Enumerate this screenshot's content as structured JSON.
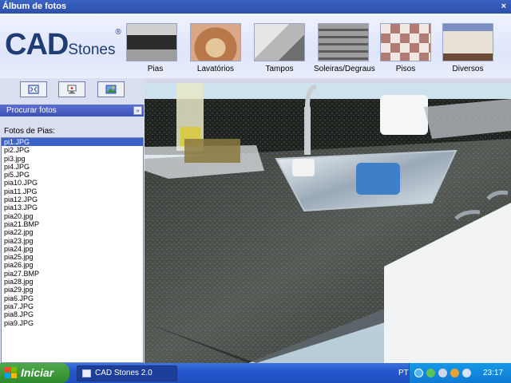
{
  "window": {
    "title": "Álbum de fotos",
    "close_glyph": "×"
  },
  "logo": {
    "main": "CAD",
    "sub": "Stones",
    "reg": "®"
  },
  "categories": [
    {
      "label": "Pias",
      "icon": "sink-thumbnail"
    },
    {
      "label": "Lavatórios",
      "icon": "washbasin-thumbnail"
    },
    {
      "label": "Tampos",
      "icon": "countertop-thumbnail"
    },
    {
      "label": "Soleiras/Degraus",
      "icon": "stairs-thumbnail"
    },
    {
      "label": "Pisos",
      "icon": "floor-thumbnail"
    },
    {
      "label": "Diversos",
      "icon": "misc-thumbnail"
    }
  ],
  "toolbar": [
    {
      "icon": "fit-image-icon"
    },
    {
      "icon": "monitor-icon"
    },
    {
      "icon": "save-image-icon"
    }
  ],
  "search": {
    "label": "Procurar fotos",
    "chevron": "»"
  },
  "files": {
    "title": "Fotos de Pias:",
    "selected": "pi1.JPG",
    "items": [
      "pi1.JPG",
      "pi2.JPG",
      "pi3.jpg",
      "pi4.JPG",
      "pi5.JPG",
      "pia10.JPG",
      "pia11.JPG",
      "pia12.JPG",
      "pia13.JPG",
      "pia20.jpg",
      "pia21.BMP",
      "pia22.jpg",
      "pia23.jpg",
      "pia24.jpg",
      "pia25.jpg",
      "pia26.jpg",
      "pia27.BMP",
      "pia28.jpg",
      "pia29.jpg",
      "pia6.JPG",
      "pia7.JPG",
      "pia8.JPG",
      "pia9.JPG"
    ]
  },
  "taskbar": {
    "start_label": "Iniciar",
    "task_label": "CAD Stones 2.0",
    "lang": "PT",
    "clock": "23:17"
  },
  "colors": {
    "titlebar": "#2c4fa8",
    "logo": "#1f3d73",
    "selection": "#3a62c8",
    "start": "#2f8a2c"
  }
}
